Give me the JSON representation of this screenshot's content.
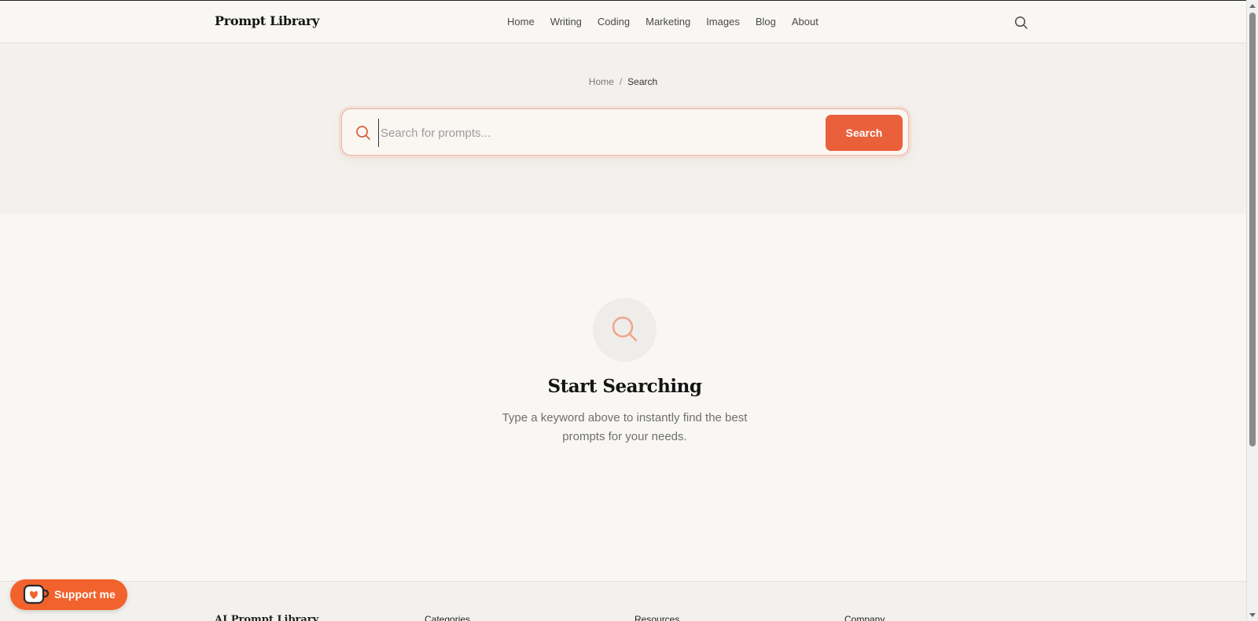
{
  "header": {
    "logo": "Prompt Library",
    "nav": [
      "Home",
      "Writing",
      "Coding",
      "Marketing",
      "Images",
      "Blog",
      "About"
    ],
    "search_icon": "search-icon"
  },
  "hero": {
    "breadcrumb": {
      "home": "Home",
      "separator": "/",
      "current": "Search"
    },
    "search": {
      "placeholder": "Search for prompts...",
      "value": "",
      "button_label": "Search"
    }
  },
  "empty_state": {
    "icon": "search-icon",
    "title": "Start Searching",
    "description": "Type a keyword above to instantly find the best prompts for your needs."
  },
  "footer": {
    "brand": "AI Prompt Library",
    "columns": [
      "Categories",
      "Resources",
      "Company"
    ]
  },
  "support": {
    "label": "Support me",
    "icon": "kofi-cup-icon"
  },
  "colors": {
    "accent": "#e9603a",
    "background": "#f9f7f4",
    "hero_background": "#f3f1ed"
  }
}
